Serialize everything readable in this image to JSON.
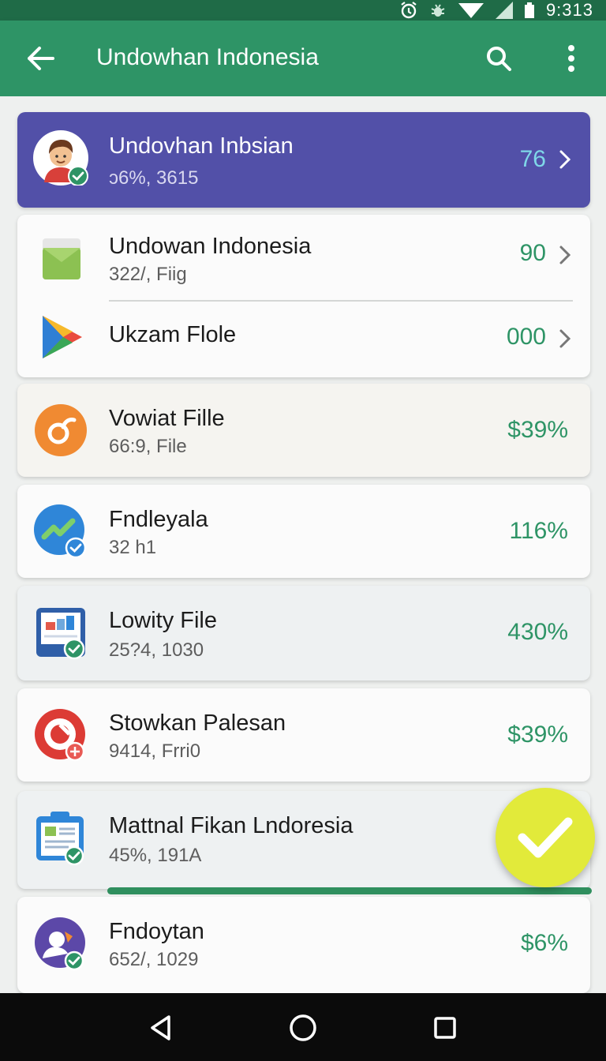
{
  "status_bar": {
    "time": "9:313",
    "icons": [
      "alarm-icon",
      "bug-icon",
      "wifi-icon",
      "signal-icon",
      "battery-icon"
    ]
  },
  "app_bar": {
    "title": "Undowhan Indonesia",
    "icons": [
      "back-arrow-icon",
      "search-icon",
      "more-vert-icon"
    ]
  },
  "colors": {
    "app_bar": "#2e9466",
    "status_bar": "#1f6b47",
    "featured_card": "#5250a8",
    "accent_green": "#2e9466",
    "fab": "#e2ea3a"
  },
  "featured": {
    "name": "Undovhan Inbsian",
    "sub": "ɔ6%, 3615",
    "value": "76"
  },
  "group": [
    {
      "name": "Undowan Indonesia",
      "sub": "322/, Fiig",
      "value": "90"
    },
    {
      "name": "Ukzam Flole",
      "value": "000"
    }
  ],
  "items": [
    {
      "name": "Vowiat Fille",
      "sub": "66:9, File",
      "value": "$39%"
    },
    {
      "name": "Fndleyala",
      "sub": "32 h1",
      "value": "116%"
    },
    {
      "name": "Lowity File",
      "sub": "25?4, 1030",
      "value": "430%"
    },
    {
      "name": "Stowkan Palesan",
      "sub": "9414, Frri0",
      "value": "$39%"
    },
    {
      "name": "Mattnal Fikan Lndoresia",
      "sub": "45%, 191A",
      "value": ""
    },
    {
      "name": "Fndoytan",
      "sub": "652/, 1029",
      "value": "$6%"
    }
  ],
  "nav_bar": {
    "icons": [
      "nav-back-icon",
      "nav-home-icon",
      "nav-recents-icon"
    ]
  }
}
